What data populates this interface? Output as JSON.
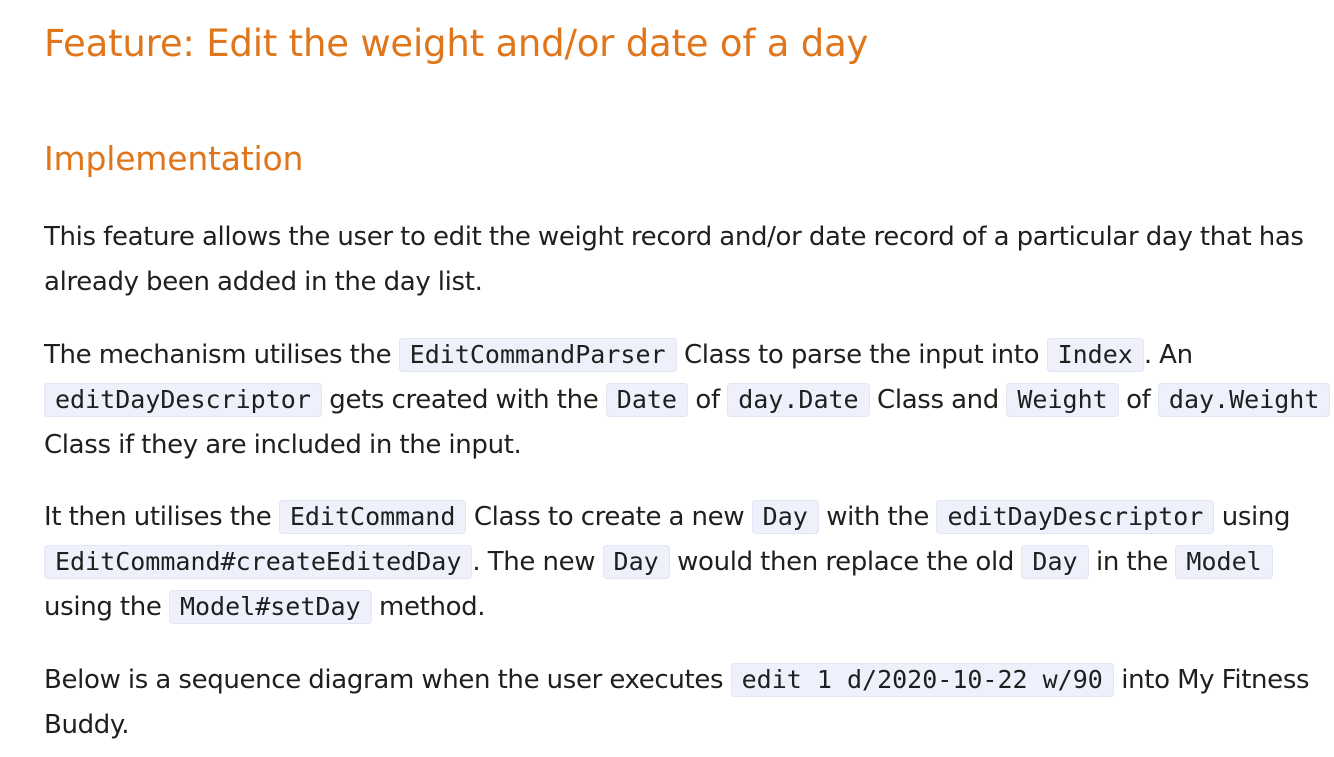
{
  "heading": "Feature: Edit the weight and/or date of a day",
  "subheading": "Implementation",
  "p1": {
    "text": "This feature allows the user to edit the weight record and/or date record of a particular day that has already been added in the day list."
  },
  "p2": {
    "t1": "The mechanism utilises the ",
    "c1": "EditCommandParser",
    "t2": " Class to parse the input into ",
    "c2": "Index",
    "t3": ". An ",
    "c3": "editDayDescriptor",
    "t4": " gets created with the ",
    "c4": "Date",
    "t5": " of ",
    "c5": "day.Date",
    "t6": " Class and ",
    "c6": "Weight",
    "t7": " of ",
    "c7": "day.Weight",
    "t8": " Class if they are included in the input."
  },
  "p3": {
    "t1": "It then utilises the ",
    "c1": "EditCommand",
    "t2": " Class to create a new ",
    "c2": "Day",
    "t3": " with the ",
    "c3": "editDayDescriptor",
    "t4": " using ",
    "c4": "EditCommand#createEditedDay",
    "t5": ". The new ",
    "c5": "Day",
    "t6": " would then replace the old ",
    "c6": "Day",
    "t7": " in the ",
    "c7": "Model",
    "t8": " using the ",
    "c8": "Model#setDay",
    "t9": " method."
  },
  "p4": {
    "t1": "Below is a sequence diagram when the user executes ",
    "c1": "edit 1 d/2020-10-22 w/90",
    "t2": " into My Fitness Buddy."
  }
}
